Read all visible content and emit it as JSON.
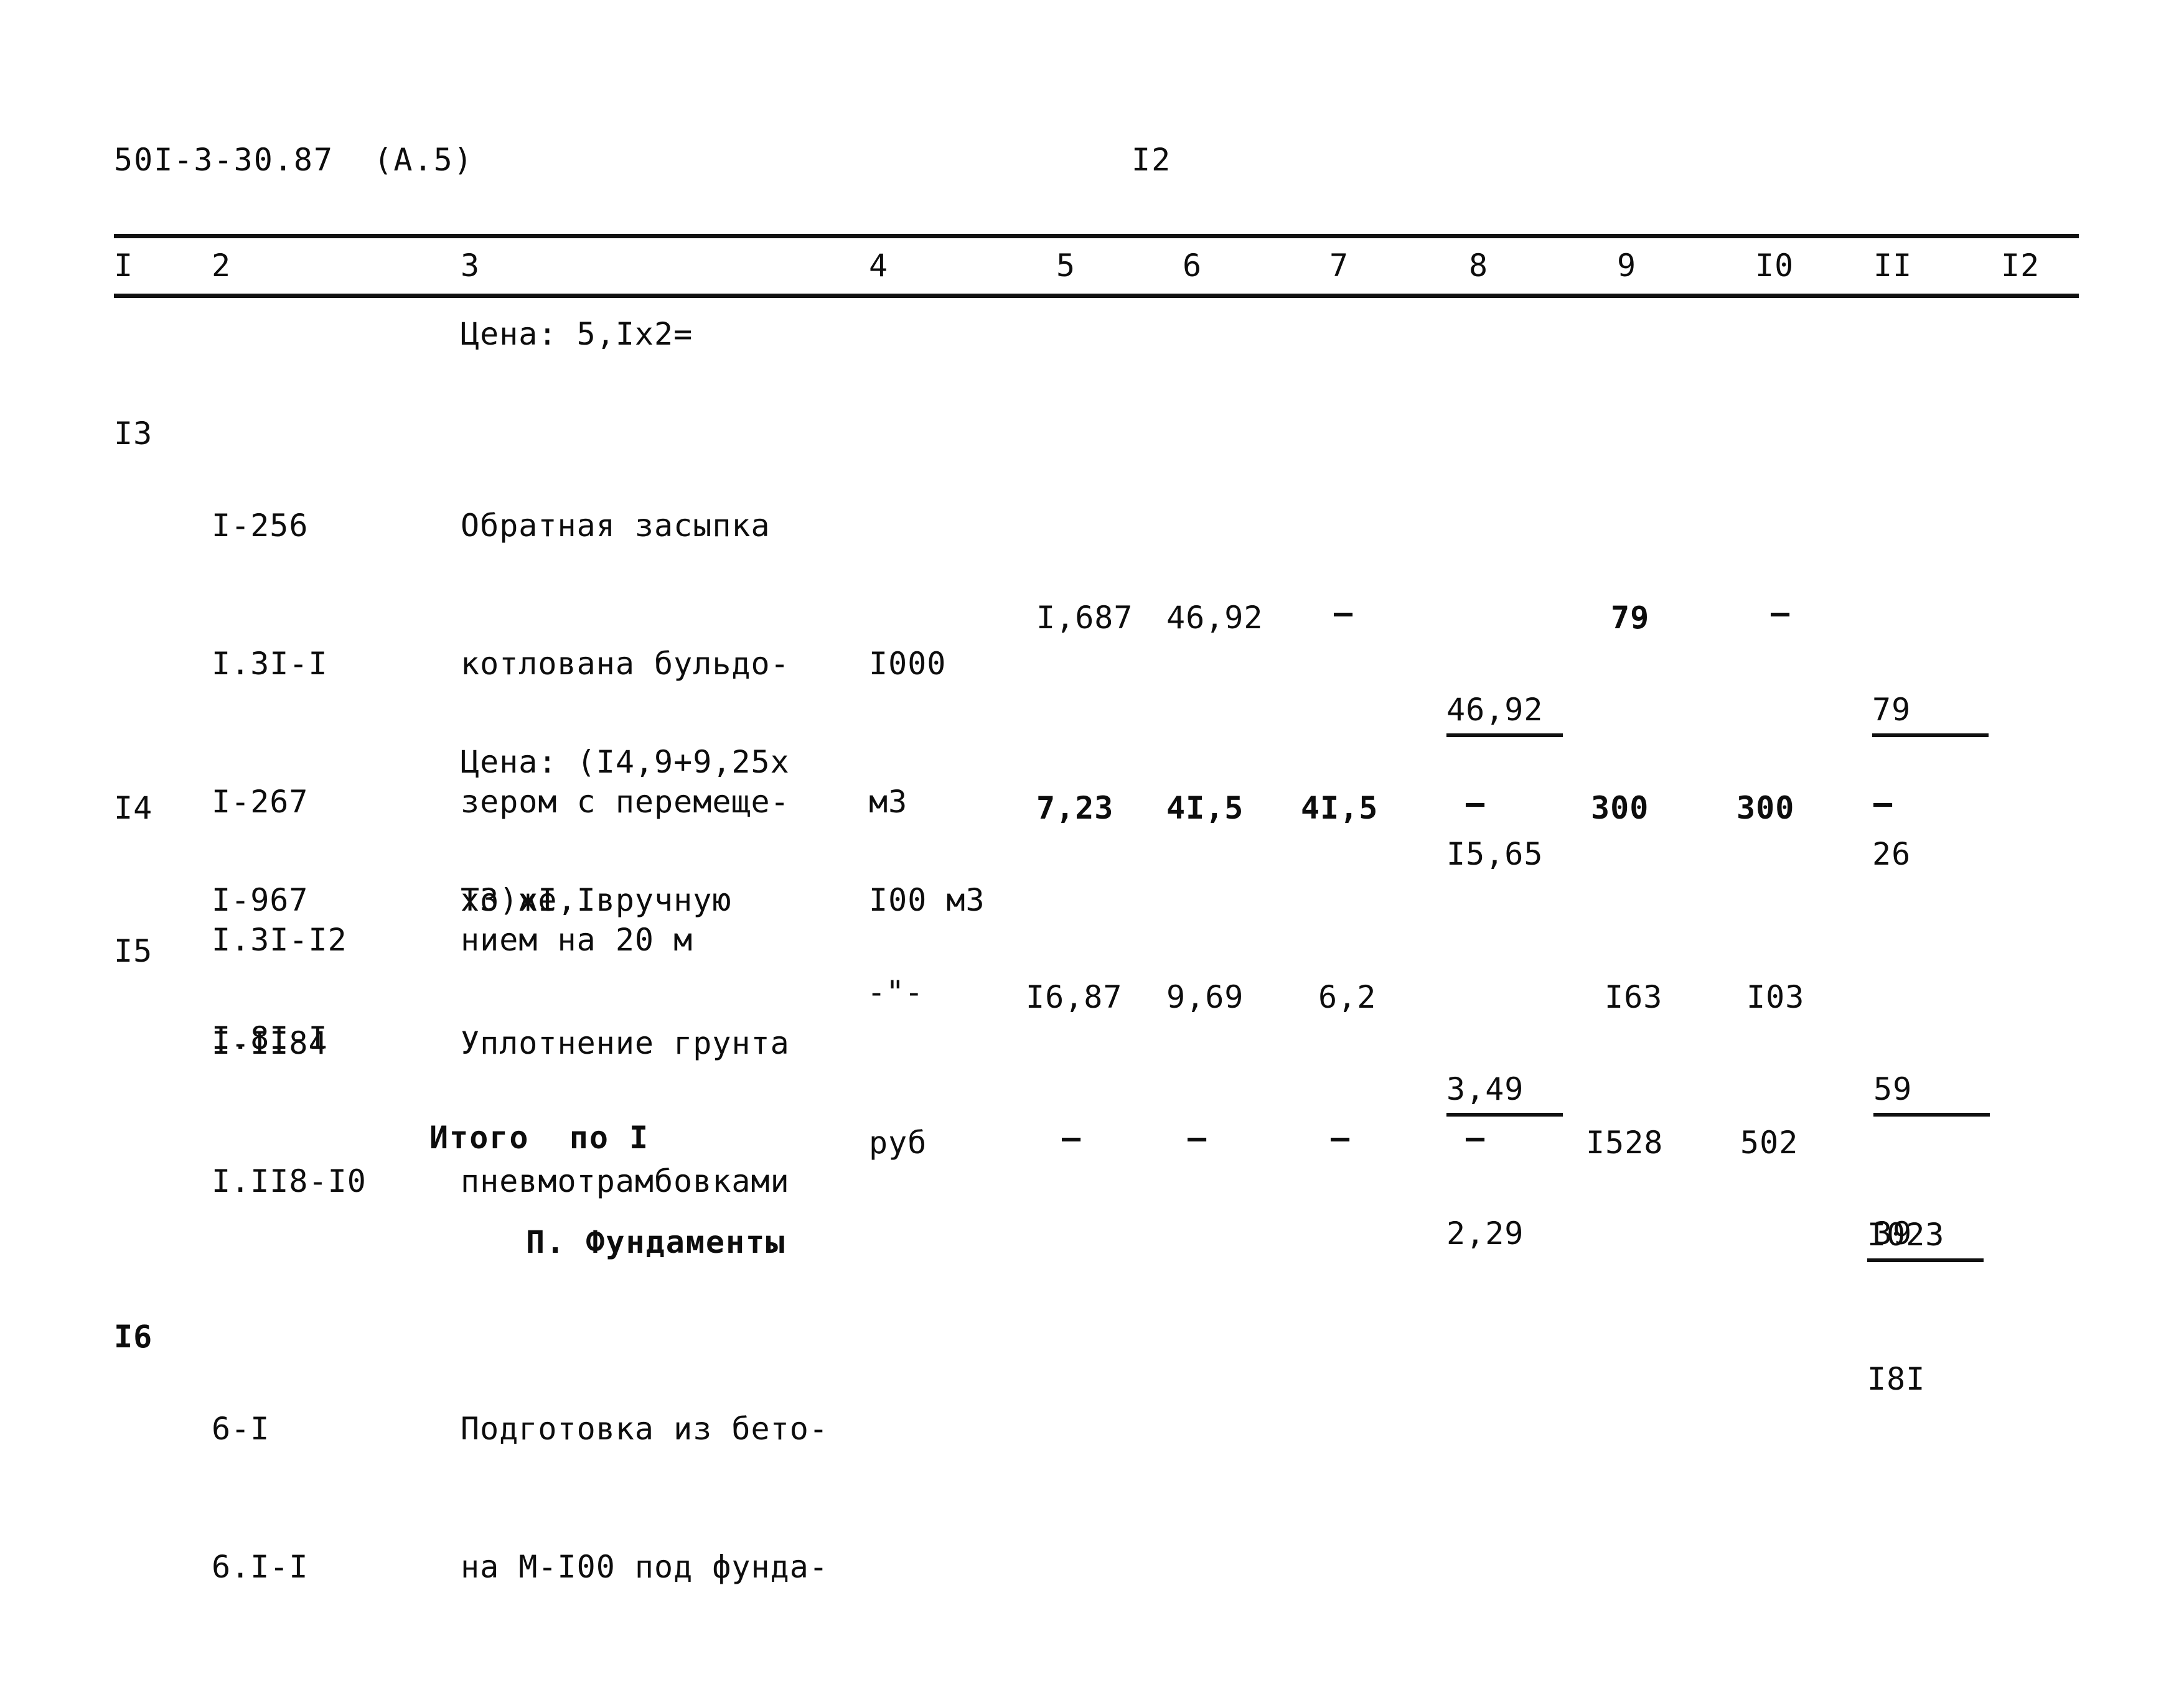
{
  "header": {
    "document_code": "50I-3-30.87  (А.5)",
    "page_number": "I2"
  },
  "table": {
    "column_headers": [
      "I",
      "2",
      "3",
      "4",
      "5",
      "6",
      "7",
      "8",
      "9",
      "I0",
      "II",
      "I2"
    ],
    "continuation_note": "Цена: 5,Iх2=",
    "rows": [
      {
        "no": "I3",
        "codes": [
          "I-256",
          "I.3I-I",
          "I-267",
          "I.3I-I2"
        ],
        "description": [
          "Обратная засыпка",
          "котлована бульдо-",
          "зером с перемеще-",
          "нием на 20 м"
        ],
        "price_note": [
          "Цена: (I4,9+9,25х",
          "х3)хI,I"
        ],
        "unit": [
          "I000",
          "м3"
        ],
        "c5": "I,687",
        "c6": "46,92",
        "c7": "–",
        "c8_numer": "46,92",
        "c8_denom": "I5,65",
        "c9": "79",
        "c10": "–",
        "c11_numer": "79",
        "c11_denom": "26",
        "c12": ""
      },
      {
        "no": "I4",
        "codes": [
          "I-967",
          "I.8I-I"
        ],
        "description": [
          "То же, вручную"
        ],
        "unit": [
          "I00 м3"
        ],
        "c5": "7,23",
        "c6": "4I,5",
        "c7": "4I,5",
        "c8": "–",
        "c9": "300",
        "c10": "300",
        "c11": "–",
        "c12": ""
      },
      {
        "no": "I5",
        "codes": [
          "I-II84",
          "I.II8-I0"
        ],
        "description": [
          "Уплотнение грунта",
          "пневмотрамбовками"
        ],
        "unit": [
          "-\"-"
        ],
        "c5": "I6,87",
        "c6": "9,69",
        "c7": "6,2",
        "c8_numer": "3,49",
        "c8_denom": "2,29",
        "c9": "I63",
        "c10": "I03",
        "c11_numer": "59",
        "c11_denom": "39",
        "c12": ""
      }
    ],
    "total_row": {
      "label": "Итого  по I",
      "unit": "руб",
      "c5": "–",
      "c6": "–",
      "c7": "–",
      "c8": "–",
      "c9": "I528",
      "c10": "502",
      "c11_numer": "I023",
      "c11_denom": "I8I"
    },
    "section_heading": "П. Фундаменты",
    "next_row": {
      "no": "I6",
      "codes": [
        "6-I",
        "6.I-I"
      ],
      "description": [
        "Подготовка из бето-",
        "на М-I00 под фунда-"
      ]
    }
  }
}
